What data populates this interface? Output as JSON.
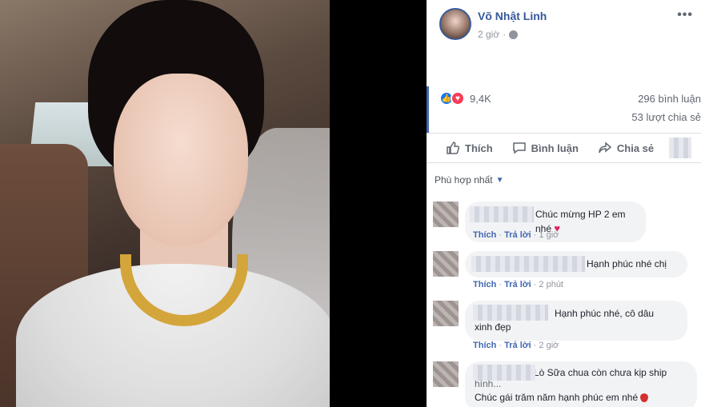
{
  "post": {
    "author_name": "Võ Nhật Linh",
    "time": "2 giờ",
    "more": "•••"
  },
  "reactions": {
    "count": "9,4K",
    "comments": "296 bình luận",
    "shares": "53 lượt chia sẻ"
  },
  "actions": {
    "like": "Thích",
    "comment": "Bình luận",
    "share": "Chia sẻ"
  },
  "sort": {
    "label": "Phù hợp nhất"
  },
  "comments": [
    {
      "text": "Chúc mừng HP 2 em nhé",
      "like": "Thích",
      "reply": "Trả lời",
      "time": "1 giờ"
    },
    {
      "text": "Hạnh phúc nhé chị",
      "like": "Thích",
      "reply": "Trả lời",
      "time": "2 phút"
    },
    {
      "text": "Hạnh phúc nhé, cô dâu",
      "text2": "xinh đẹp",
      "like": "Thích",
      "reply": "Trả lời",
      "time": "2 giờ"
    },
    {
      "text": "Lò Sữa chua còn chưa kịp ship",
      "text2": "hình...",
      "text3": "Chúc gái trăm năm hạnh phúc em nhé"
    }
  ],
  "colors": {
    "link": "#365899",
    "accent": "#4267b2",
    "like": "#1877f2",
    "love": "#f33e58"
  }
}
